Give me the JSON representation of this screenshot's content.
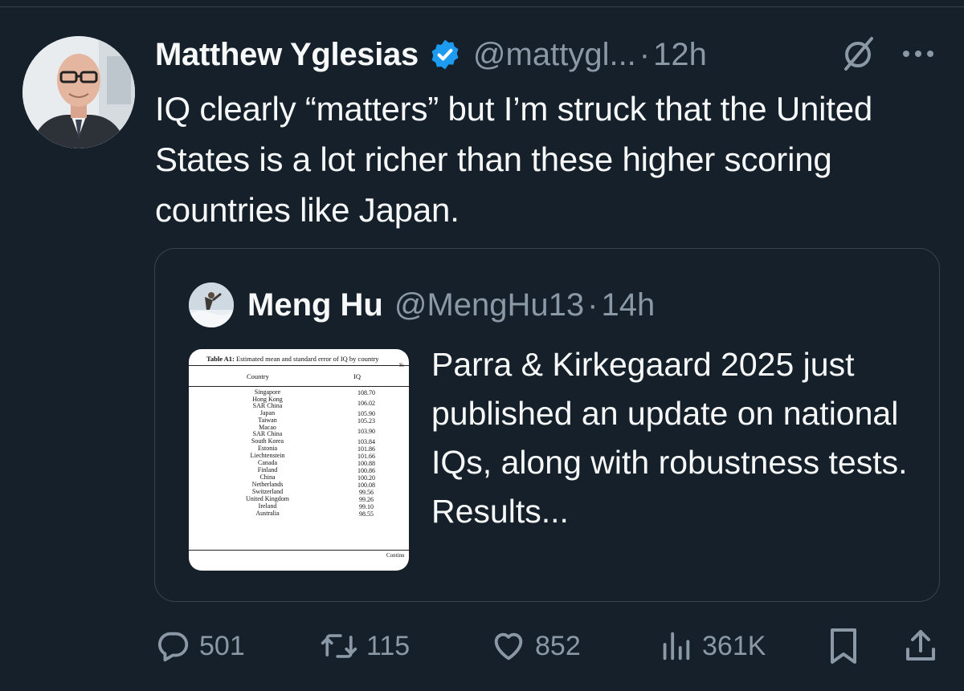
{
  "tweet": {
    "author_name": "Matthew Yglesias",
    "handle": "@mattygl...",
    "separator": "·",
    "time": "12h",
    "text": "IQ clearly “matters” but I’m struck that the United States is a lot richer than these higher scoring countries like Japan.",
    "icons": {
      "verified": "verified-badge-icon",
      "grok": "grok-icon",
      "more": "more-options-icon"
    },
    "colors": {
      "verified": "#1d9bf0",
      "background": "#15202b",
      "muted": "#8b98a5"
    }
  },
  "quote": {
    "author_name": "Meng Hu",
    "handle": "@MengHu13",
    "separator": "·",
    "time": "14h",
    "text": "Parra & Kirkegaard 2025 just published an update on national IQs, along with robustness tests. Results...",
    "image": {
      "caption_label": "Table A1:",
      "caption_text": "Estimated mean and standard error of IQ by country",
      "edge_fragment": "Sı",
      "header_country": "Country",
      "header_iq": "IQ",
      "continued": "Continu",
      "rows": [
        {
          "country": "Singapore",
          "iq": "108.70"
        },
        {
          "country": "Hong Kong\nSAR China",
          "iq": "106.02"
        },
        {
          "country": "Japan",
          "iq": "105.90"
        },
        {
          "country": "Taiwan",
          "iq": "105.23"
        },
        {
          "country": "Macao\nSAR China",
          "iq": "103.90"
        },
        {
          "country": "South Korea",
          "iq": "103.84"
        },
        {
          "country": "Estonia",
          "iq": "101.86"
        },
        {
          "country": "Liechtenstein",
          "iq": "101.66"
        },
        {
          "country": "Canada",
          "iq": "100.88"
        },
        {
          "country": "Finland",
          "iq": "100.86"
        },
        {
          "country": "China",
          "iq": "100.20"
        },
        {
          "country": "Netherlands",
          "iq": "100.08"
        },
        {
          "country": "Switzerland",
          "iq": "99.56"
        },
        {
          "country": "United Kingdom",
          "iq": "99.26"
        },
        {
          "country": "Ireland",
          "iq": "99.10"
        },
        {
          "country": "Australia",
          "iq": "98.55"
        }
      ]
    }
  },
  "actions": {
    "replies": "501",
    "retweets": "115",
    "likes": "852",
    "views": "361K",
    "icons": [
      "reply-icon",
      "retweet-icon",
      "like-icon",
      "views-icon",
      "bookmark-icon",
      "share-icon"
    ]
  }
}
